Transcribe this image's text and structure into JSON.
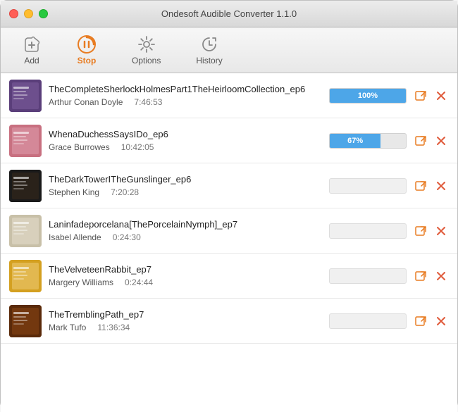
{
  "app": {
    "title": "Ondesoft Audible Converter 1.1.0"
  },
  "toolbar": {
    "items": [
      {
        "id": "add",
        "label": "Add",
        "active": false
      },
      {
        "id": "stop",
        "label": "Stop",
        "active": true
      },
      {
        "id": "options",
        "label": "Options",
        "active": false
      },
      {
        "id": "history",
        "label": "History",
        "active": false
      }
    ]
  },
  "books": [
    {
      "id": 1,
      "title": "TheCompleteSherlockHolmesPart1TheHeirloomCollection_ep6",
      "author": "Arthur Conan Doyle",
      "duration": "7:46:53",
      "progress": 100,
      "progress_label": "100%",
      "cover_class": "cover-1"
    },
    {
      "id": 2,
      "title": "WhenaDuchessSaysIDo_ep6",
      "author": "Grace Burrowes",
      "duration": "10:42:05",
      "progress": 67,
      "progress_label": "67%",
      "cover_class": "cover-2"
    },
    {
      "id": 3,
      "title": "TheDarkTowerITheGunslinger_ep6",
      "author": "Stephen King",
      "duration": "7:20:28",
      "progress": 0,
      "progress_label": "",
      "cover_class": "cover-3"
    },
    {
      "id": 4,
      "title": "Laninfadeporcelana[ThePorcelainNymph]_ep7",
      "author": "Isabel Allende",
      "duration": "0:24:30",
      "progress": 0,
      "progress_label": "",
      "cover_class": "cover-4"
    },
    {
      "id": 5,
      "title": "TheVelveteenRabbit_ep7",
      "author": "Margery Williams",
      "duration": "0:24:44",
      "progress": 0,
      "progress_label": "",
      "cover_class": "cover-5"
    },
    {
      "id": 6,
      "title": "TheTremblingPath_ep7",
      "author": "Mark Tufo",
      "duration": "11:36:34",
      "progress": 0,
      "progress_label": "",
      "cover_class": "cover-6"
    }
  ]
}
